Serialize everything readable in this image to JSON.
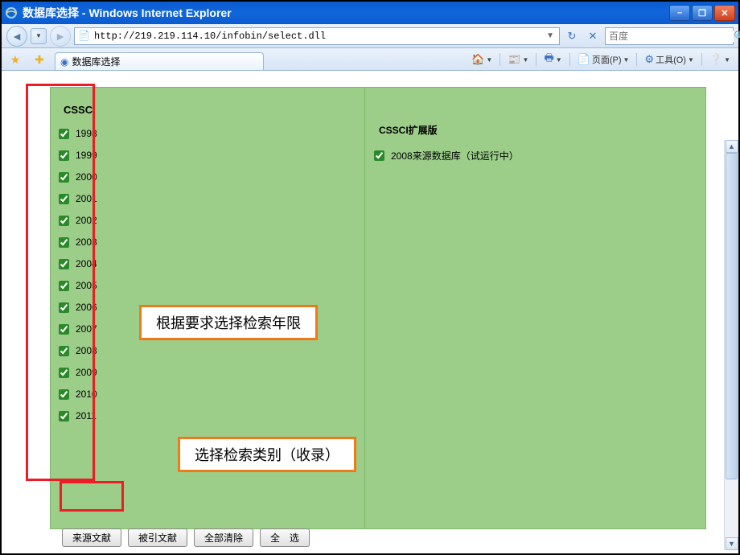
{
  "window": {
    "title": "数据库选择 - Windows Internet Explorer"
  },
  "nav": {
    "url": "http://219.219.114.10/infobin/select.dll",
    "search_placeholder": "百度"
  },
  "tab": {
    "title": "数据库选择"
  },
  "cmds": {
    "page": "页面(P)",
    "tools": "工具(O)"
  },
  "left": {
    "header": "CSSCI",
    "years": [
      "1998",
      "1999",
      "2000",
      "2001",
      "2002",
      "2003",
      "2004",
      "2005",
      "2006",
      "2007",
      "2008",
      "2009",
      "2010",
      "2011"
    ]
  },
  "right": {
    "header": "CSSCI扩展版",
    "item": "2008来源数据库（试运行中）"
  },
  "annot": {
    "a1": "根据要求选择检索年限",
    "a2": "选择检索类别（收录）"
  },
  "buttons": {
    "b1": "来源文献",
    "b2": "被引文献",
    "b3": "全部清除",
    "b4": "全　选"
  }
}
